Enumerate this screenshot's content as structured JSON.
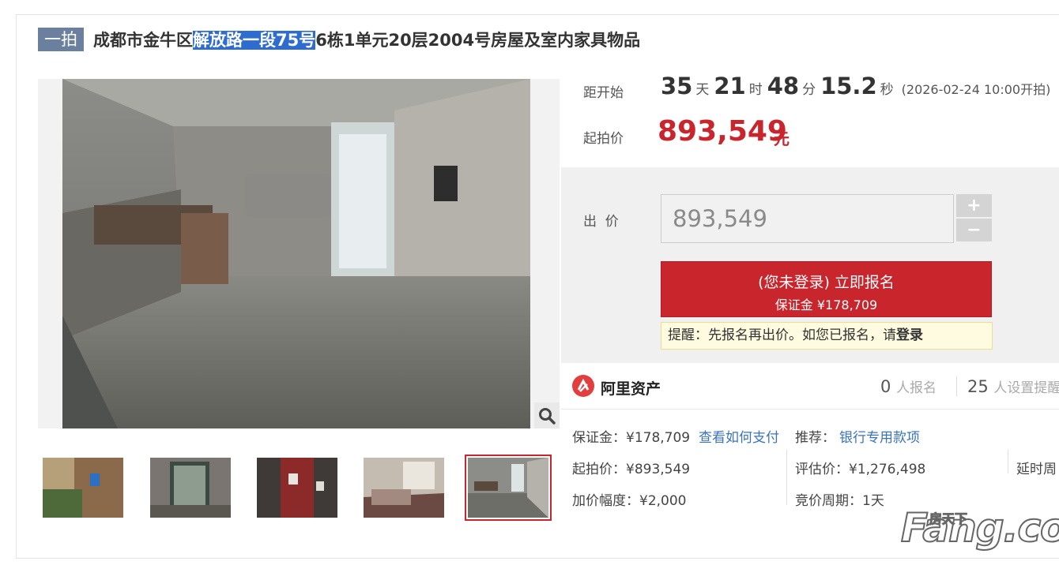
{
  "header": {
    "badge": "一拍",
    "title_pre": "成都市金牛区",
    "title_highlight": "解放路一段75号",
    "title_post": "6栋1单元20层2004号房屋及室内家具物品"
  },
  "countdown": {
    "label": "距开始",
    "days": "35",
    "days_unit": "天",
    "hours": "21",
    "hours_unit": "时",
    "minutes": "48",
    "minutes_unit": "分",
    "seconds": "15.2",
    "seconds_unit": "秒",
    "start_note": "(2026-02-24 10:00开拍)"
  },
  "start_price": {
    "label": "起拍价",
    "value": "893,549",
    "unit": "元"
  },
  "bid": {
    "label": "出  价",
    "value": "893,549",
    "plus": "+",
    "minus": "−",
    "signup_line1": "(您未登录) 立即报名",
    "signup_line2": "保证金 ¥178,709",
    "tip_text": "提醒：先报名再出价。如您已报名，请",
    "tip_login": "登录"
  },
  "platform": {
    "name": "阿里资产",
    "signups": "0",
    "signups_label": "人报名",
    "reminders": "25",
    "reminders_label": "人设置提醒"
  },
  "details": {
    "deposit": "保证金：¥178,709",
    "how_to_pay": "查看如何支付",
    "recommend_label": "推荐：",
    "recommend_link": "银行专用款项",
    "start_price": "起拍价：¥893,549",
    "valuation": "评估价：¥1,276,498",
    "delay": "延时周",
    "increment": "加价幅度：¥2,000",
    "cycle": "竞价周期：1天"
  },
  "watermark": {
    "main": "Fang.com",
    "sub": "房天下"
  },
  "colors": {
    "accent_red": "#c9252c",
    "badge": "#6b7f9e",
    "link": "#3b73b9"
  }
}
